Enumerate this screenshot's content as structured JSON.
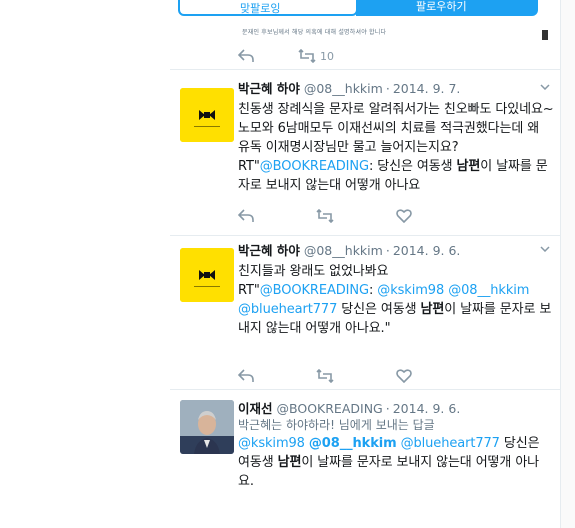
{
  "partial_top": {
    "tab_left_label": "맞팔로잉",
    "tab_right_label": "팔로우하기",
    "small_text": "문재인 후보님께서 해당 의혹에 대해 설명하셔야 합니다",
    "retweet_count": "10"
  },
  "tweets": [
    {
      "author": "박근혜 하야",
      "handle": "@08__hkkim",
      "date": "2014. 9. 7.",
      "text_plain": "친동생 장례식을 문자로  알려줘서가는 친오빠도 다있네요~노모와 6남매모두 이재선씨의 치료를 적극권했다는데 왜 유독 이재명시장님만 물고 늘어지는지요?RT\"",
      "mention": "@BOOKREADING",
      "text_after_mention": ": 당신은 여동생 ",
      "bold_word": "남편",
      "text_end": "이 날짜를 문자로 보내지 않는대 어떻개 아나요"
    },
    {
      "author": "박근혜 하야",
      "handle": "@08__hkkim",
      "date": "2014. 9. 6.",
      "line1": "친지들과 왕래도 없었나봐요",
      "rt_prefix": "RT\"",
      "mention1": "@BOOKREADING",
      "sep1": ": ",
      "mention2": "@kskim98",
      "mention3": "@08__hkkim",
      "mention4": "@blueheart777",
      "text_mid": " 당신은 여동생 ",
      "bold_word": "남편",
      "text_end": "이 날짜를 문자로 보내지 않는대 어떻개 아나요.\""
    },
    {
      "author": "이재선",
      "handle": "@BOOKREADING",
      "date": "2014. 9. 6.",
      "reply_to": "박근혜는 하야하라! 님에게 보내는 답글",
      "mention1": "@kskim98",
      "mention2": "@08__hkkim",
      "mention3": "@blueheart777",
      "text_mid": " 당신은 여동생 ",
      "bold_word": "남편",
      "text_end": "이 날짜를 문자로 보내지 않는대 어떻개 아나요."
    }
  ],
  "separator": "·",
  "icons": [
    "reply-icon",
    "retweet-icon",
    "like-icon",
    "chevron-down-icon",
    "avatar-logo-icon"
  ]
}
